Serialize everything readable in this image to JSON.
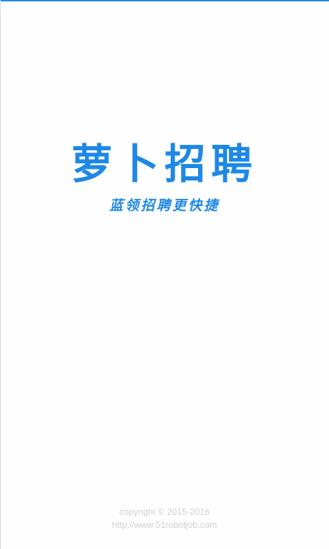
{
  "splash": {
    "title": "萝卜招聘",
    "slogan": "蓝领招聘更快捷"
  },
  "footer": {
    "copyright": "copyright © 2015-2016",
    "url": "http://www.51robotjob.com"
  },
  "colors": {
    "brand": "#1e88e5",
    "footer_text": "#d0d0d0",
    "background": "#fefeff"
  }
}
